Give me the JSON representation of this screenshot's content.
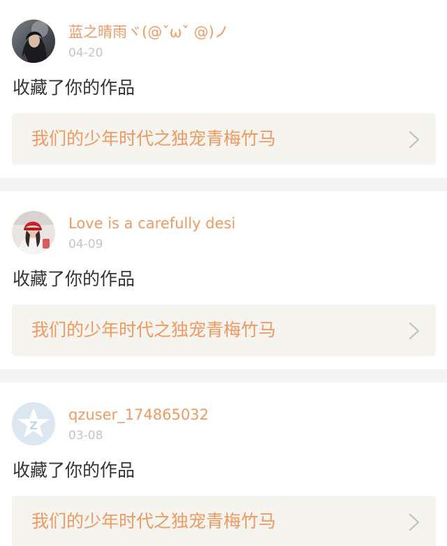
{
  "notifications": [
    {
      "username": "蓝之晴雨ヾ(@ˇωˇ @)ノ",
      "date": "04-20",
      "action": "收藏了你的作品",
      "work_title": "我们的少年时代之独宠青梅竹马",
      "avatar": "girl-photo-avatar"
    },
    {
      "username": "Love is a carefully desi",
      "date": "04-09",
      "action": "收藏了你的作品",
      "work_title": "我们的少年时代之独宠青梅竹马",
      "avatar": "girl-red-hat-avatar"
    },
    {
      "username": "qzuser_174865032",
      "date": "03-08",
      "action": "收藏了你的作品",
      "work_title": "我们的少年时代之独宠青梅竹马",
      "avatar": "qzone-default-avatar"
    }
  ],
  "colors": {
    "accent": "#ee9a62",
    "date": "#c4c4c4",
    "text": "#333333",
    "card_bg": "#f5f4ee",
    "separator": "#f4f4f4"
  },
  "icons": {
    "card_arrow": "chevron-right-icon"
  }
}
